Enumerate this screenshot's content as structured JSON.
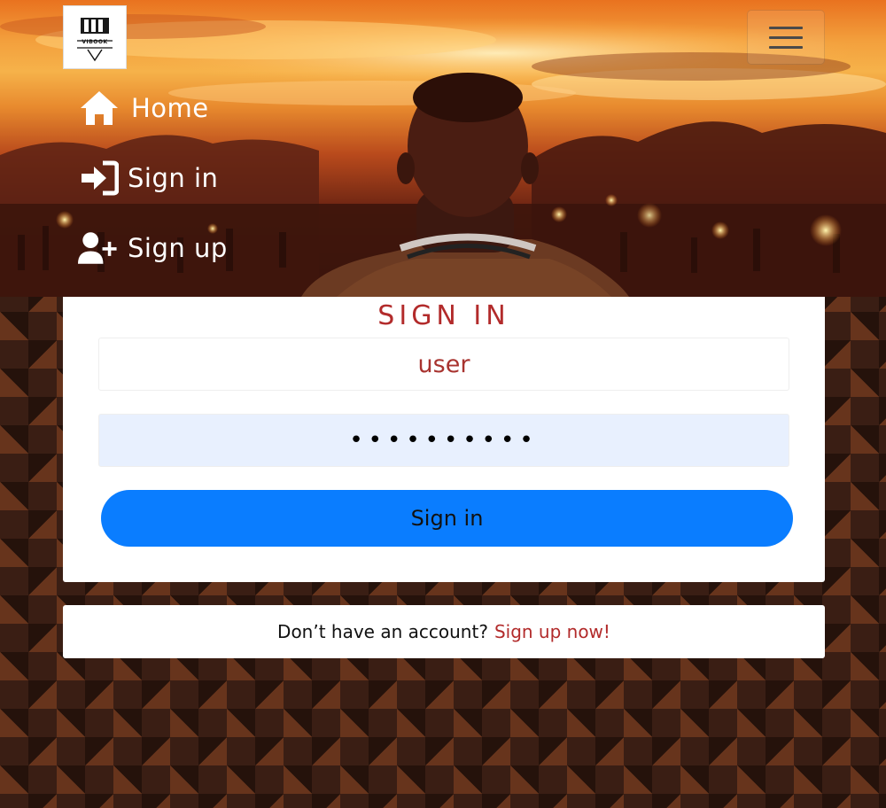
{
  "brand": {
    "logo_text": "VIBOOK"
  },
  "nav": {
    "items": [
      {
        "label": "Home",
        "icon": "home-icon"
      },
      {
        "label": "Sign in",
        "icon": "sign-in-icon"
      },
      {
        "label": "Sign up",
        "icon": "user-plus-icon"
      }
    ],
    "menu_icon": "hamburger-icon"
  },
  "signin": {
    "title": "SIGN IN",
    "username_value": "user",
    "password_value": "••••••••••",
    "button_label": "Sign in"
  },
  "signup_prompt": {
    "text": "Don’t have an account?",
    "link": "Sign up now!"
  },
  "colors": {
    "accent_red": "#b22b2b",
    "button_blue": "#0a7dff",
    "autofill_blue": "#e8f0fe"
  }
}
